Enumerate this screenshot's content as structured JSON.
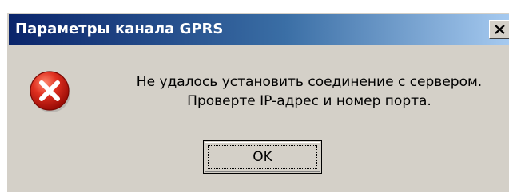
{
  "dialog": {
    "title": "Параметры канала GPRS",
    "close_glyph": "X",
    "icon": "error-icon",
    "message_lines": [
      "Не удалось установить соединение с сервером.",
      "Проверте IP-адрес и номер порта."
    ],
    "ok_label": "OK"
  },
  "colors": {
    "titlebar_start": "#0a246a",
    "titlebar_end": "#a6caf0",
    "face": "#d4d0c8",
    "error_red": "#e03020"
  }
}
